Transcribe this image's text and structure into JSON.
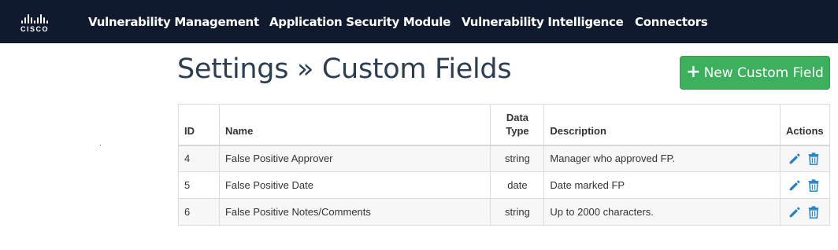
{
  "nav": {
    "logo_text": "CISCO",
    "items": [
      {
        "label": "Vulnerability Management"
      },
      {
        "label": "Application Security Module"
      },
      {
        "label": "Vulnerability Intelligence"
      },
      {
        "label": "Connectors"
      }
    ]
  },
  "page": {
    "title": "Settings » Custom Fields",
    "new_button_icon": "plus-icon",
    "new_button_label": "New Custom Field"
  },
  "table": {
    "headers": {
      "id": "ID",
      "name": "Name",
      "data_type_line1": "Data",
      "data_type_line2": "Type",
      "description": "Description",
      "actions": "Actions"
    },
    "rows": [
      {
        "id": "4",
        "name": "False Positive Approver",
        "data_type": "string",
        "description": "Manager who approved FP."
      },
      {
        "id": "5",
        "name": "False Positive Date",
        "data_type": "date",
        "description": "Date marked FP"
      },
      {
        "id": "6",
        "name": "False Positive Notes/Comments",
        "data_type": "string",
        "description": "Up to 2000 characters."
      }
    ],
    "row_actions": [
      "edit-pencil-icon",
      "delete-trash-icon"
    ]
  },
  "colors": {
    "topbar": "#0f1a2e",
    "primary_button": "#3cb05c",
    "action_icon": "#1f7fc4",
    "title": "#2c3e50"
  }
}
